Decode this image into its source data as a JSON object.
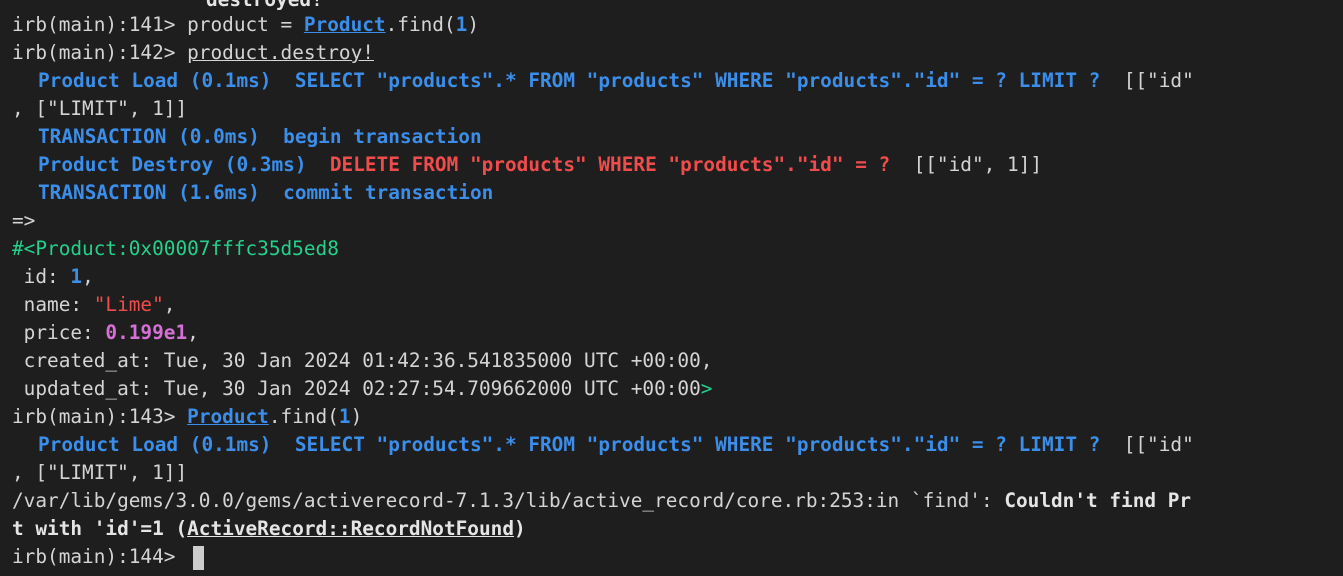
{
  "lines": {
    "l0": "destroyed!",
    "l1_prompt": "irb(main):141> ",
    "l1_a": "product = ",
    "l1_const": "Product",
    "l1_b": ".find(",
    "l1_num": "1",
    "l1_c": ")",
    "l2_prompt": "irb(main):142> ",
    "l2_cmd": "product.destroy!",
    "l3_label": "Product Load (0.1ms)",
    "l3_sql": "  SELECT \"products\".* FROM \"products\" WHERE \"products\".\"id\" = ? LIMIT ?",
    "l3_binds": "  [[\"id\"",
    "l4": ", [\"LIMIT\", 1]]",
    "l5_label": "TRANSACTION (0.0ms)",
    "l5_sql": "  begin transaction",
    "l6_label": "Product Destroy (0.3ms)",
    "l6_sql": "  DELETE FROM \"products\" WHERE \"products\".\"id\" = ?",
    "l6_binds": "  [[\"id\", 1]]",
    "l7_label": "TRANSACTION (1.6ms)",
    "l7_sql": "  commit transaction",
    "l8": "=>",
    "l9": "#<Product:0x00007fffc35d5ed8",
    "l10_key": " id: ",
    "l10_val": "1",
    "l10_end": ",",
    "l11_key": " name: ",
    "l11_val": "\"Lime\"",
    "l11_end": ",",
    "l12_key": " price: ",
    "l12_val": "0.199e1",
    "l12_end": ",",
    "l13": " created_at: Tue, 30 Jan 2024 01:42:36.541835000 UTC +00:00,",
    "l14_text": " updated_at: Tue, 30 Jan 2024 02:27:54.709662000 UTC +00:00",
    "l14_end": ">",
    "l15_prompt": "irb(main):143> ",
    "l15_const": "Product",
    "l15_b": ".find(",
    "l15_num": "1",
    "l15_c": ")",
    "l16_label": "Product Load (0.1ms)",
    "l16_sql": "  SELECT \"products\".* FROM \"products\" WHERE \"products\".\"id\" = ? LIMIT ?",
    "l16_binds": "  [[\"id\"",
    "l17": ", [\"LIMIT\", 1]]",
    "l18_path": "/var/lib/gems/3.0.0/gems/activerecord-7.1.3/lib/active_record/core.rb:253:in `find': ",
    "l18_msg": "Couldn't find Pr",
    "l19_a": "t with 'id'=1 (",
    "l19_cls": "ActiveRecord::RecordNotFound",
    "l19_b": ")",
    "l20_prompt": "irb(main):144> "
  }
}
